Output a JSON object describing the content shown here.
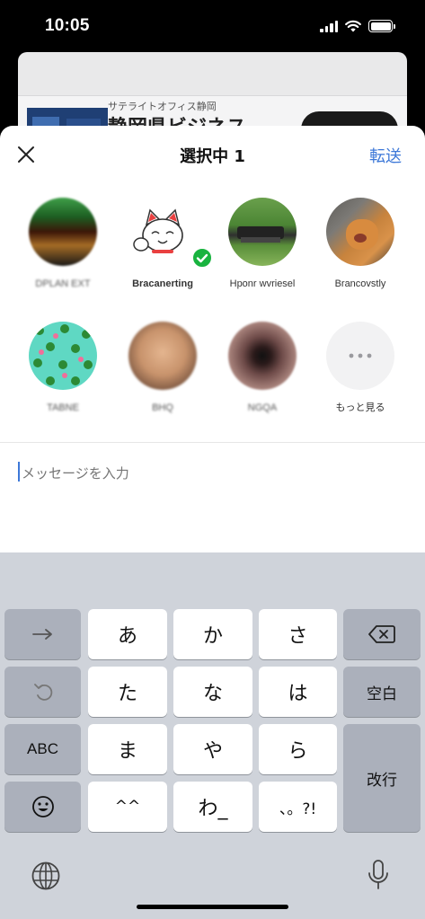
{
  "status": {
    "time": "10:05"
  },
  "background": {
    "ad_subtitle": "サテライトオフィス静岡",
    "ad_title": "静岡県ビジネス"
  },
  "sheet": {
    "title": "選択中 1",
    "forward_label": "転送",
    "contacts": [
      {
        "name": "DPLAN EXT",
        "blurred": true,
        "selected": false
      },
      {
        "name": "Bracanerting",
        "blurred": false,
        "selected": true
      },
      {
        "name": "Hponr wvriesel",
        "blurred": false,
        "selected": false
      },
      {
        "name": "Brancovstly",
        "blurred": false,
        "selected": false
      },
      {
        "name": "TABNE",
        "blurred": true,
        "selected": false
      },
      {
        "name": "BHQ",
        "blurred": true,
        "selected": false
      },
      {
        "name": "NGQA",
        "blurred": true,
        "selected": false
      },
      {
        "name": "もっと見る",
        "blurred": false,
        "selected": false
      }
    ],
    "more_icon": "ellipsis-icon",
    "message_placeholder": "メッセージを入力"
  },
  "keyboard": {
    "keys": {
      "arrow": "→",
      "a": "あ",
      "ka": "か",
      "sa": "さ",
      "ta": "た",
      "na": "な",
      "ha": "は",
      "ma": "ま",
      "ya": "や",
      "ra": "ら",
      "kao": "^^",
      "wa": "わ_",
      "punct": "、。?!",
      "abc": "ABC",
      "space": "空白",
      "return": "改行"
    },
    "icons": [
      "delete-icon",
      "undo-icon",
      "emoji-icon",
      "globe-icon",
      "microphone-icon"
    ]
  },
  "colors": {
    "accent": "#3d78d8",
    "check": "#19b33f",
    "keyboard_bg": "#cfd3da"
  }
}
